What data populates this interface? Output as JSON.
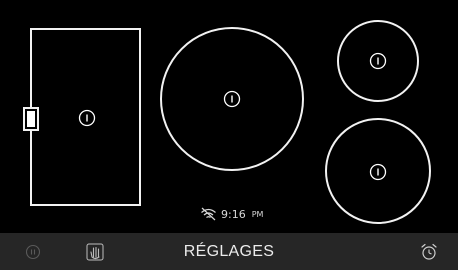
{
  "cooktop": {
    "zones": [
      {
        "id": "left-bridge-zone",
        "power_icon": "power-icon"
      },
      {
        "id": "center-large-zone",
        "power_icon": "power-icon"
      },
      {
        "id": "right-top-small-zone",
        "power_icon": "power-icon"
      },
      {
        "id": "right-bottom-medium-zone",
        "power_icon": "power-icon"
      }
    ],
    "zone_outline_color": "#f2f2f2"
  },
  "status": {
    "wifi_icon": "wifi-off-icon",
    "time": "9:16",
    "ampm": "PM"
  },
  "bottom_bar": {
    "background": "#262626",
    "settings_label": "RÉGLAGES",
    "left_icons": [
      "pause-icon",
      "hand-lock-icon"
    ],
    "right_icon": "alarm-clock-icon"
  }
}
